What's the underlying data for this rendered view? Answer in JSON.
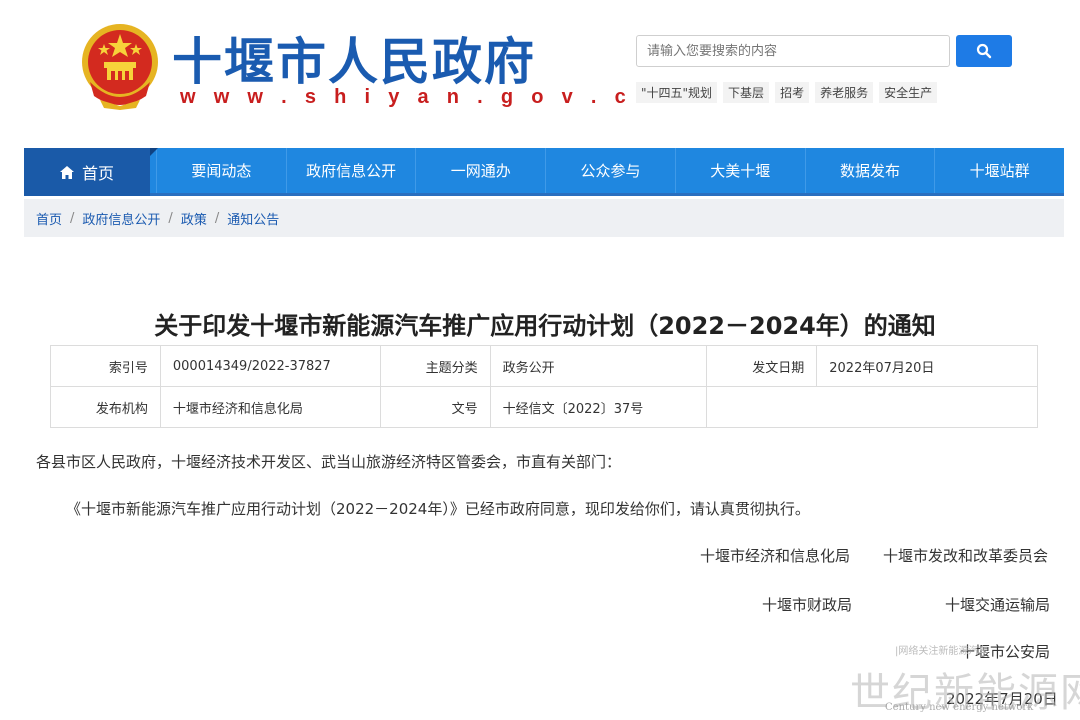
{
  "header": {
    "title": "十堰市人民政府",
    "url": "w w w . s h i y a n . g o v . c n",
    "search_placeholder": "请输入您要搜索的内容",
    "hotwords": [
      "\"十四五\"规划",
      "下基层",
      "招考",
      "养老服务",
      "安全生产"
    ]
  },
  "nav": {
    "home": "首页",
    "items": [
      "要闻动态",
      "政府信息公开",
      "一网通办",
      "公众参与",
      "大美十堰",
      "数据发布",
      "十堰站群"
    ]
  },
  "breadcrumb": [
    "首页",
    "政府信息公开",
    "政策",
    "通知公告"
  ],
  "article": {
    "title": "关于印发十堰市新能源汽车推广应用行动计划（2022－2024年）的通知",
    "meta": {
      "index_label": "索引号",
      "index_value": "000014349/2022-37827",
      "topic_label": "主题分类",
      "topic_value": "政务公开",
      "date_label": "发文日期",
      "date_value": "2022年07月20日",
      "org_label": "发布机构",
      "org_value": "十堰市经济和信息化局",
      "doc_label": "文号",
      "doc_value": "十经信文〔2022〕37号"
    },
    "salutation": "各县市区人民政府，十堰经济技术开发区、武当山旅游经济特区管委会，市直有关部门：",
    "paragraph": "《十堰市新能源汽车推广应用行动计划（2022－2024年）》已经市政府同意，现印发给你们，请认真贯彻执行。",
    "signatures": [
      "十堰市经济和信息化局",
      "十堰市发改和改革委员会",
      "十堰市财政局",
      "十堰交通运输局",
      "十堰市公安局"
    ],
    "sign_date": "2022年7月20日"
  },
  "watermark": {
    "caption": "|网络关注新能源汽车",
    "text": "世纪新能源网",
    "english": "Century new energy network"
  },
  "colors": {
    "title_blue": "#1a5bb0",
    "url_red": "#c81e1e",
    "nav_blue": "#1f87e0",
    "nav_home": "#1a5aa8",
    "search_btn": "#1e7be6"
  }
}
